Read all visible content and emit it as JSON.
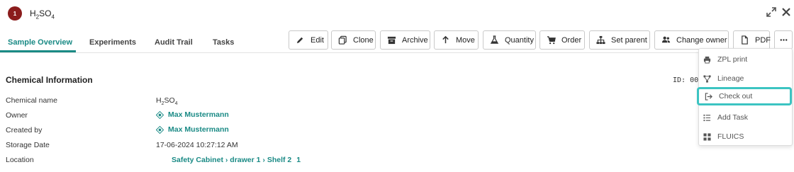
{
  "header": {
    "badge_number": "1",
    "title_main": "H",
    "title_sub1": "2",
    "title_mid": "SO",
    "title_sub2": "4"
  },
  "tabs": [
    {
      "label": "Sample Overview",
      "active": true
    },
    {
      "label": "Experiments",
      "active": false
    },
    {
      "label": "Audit Trail",
      "active": false
    },
    {
      "label": "Tasks",
      "active": false
    }
  ],
  "toolbar": {
    "edit": "Edit",
    "clone": "Clone",
    "archive": "Archive",
    "move": "Move",
    "quantity": "Quantity",
    "order": "Order",
    "set_parent": "Set parent",
    "change_owner": "Change owner",
    "pdf": "PDF"
  },
  "section": {
    "title": "Chemical Information",
    "id_label": "ID: 00"
  },
  "fields": {
    "chemical_name_label": "Chemical name",
    "chemical_name_main": "H",
    "chemical_name_sub1": "2",
    "chemical_name_mid": "SO",
    "chemical_name_sub2": "4",
    "owner_label": "Owner",
    "owner_value": "Max Mustermann",
    "created_by_label": "Created by",
    "created_by_value": "Max Mustermann",
    "storage_date_label": "Storage Date",
    "storage_date_value": "17-06-2024 10:27:12 AM",
    "location_label": "Location",
    "location_parts": [
      "Safety Cabinet",
      "drawer 1",
      "Shelf 2",
      "1"
    ]
  },
  "menu": {
    "items": [
      {
        "label": "ZPL print",
        "icon": "printer-icon"
      },
      {
        "label": "Lineage",
        "icon": "lineage-icon"
      },
      {
        "label": "Check out",
        "icon": "checkout-icon"
      },
      {
        "label": "Add Task",
        "icon": "list-icon"
      },
      {
        "label": "FLUICS",
        "icon": "grid-icon"
      }
    ]
  },
  "colors": {
    "accent": "#1a8a85",
    "badge": "#8b1c1c",
    "highlight": "#3cc4c2"
  }
}
